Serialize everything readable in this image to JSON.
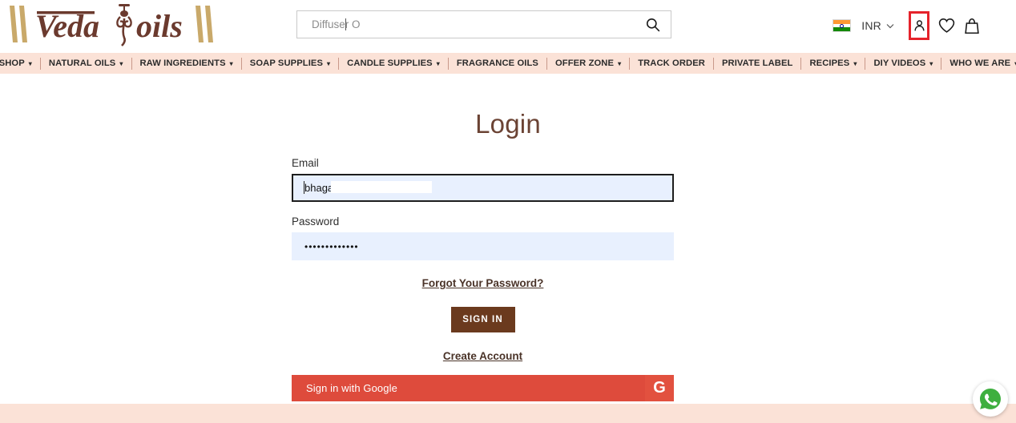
{
  "brand": {
    "name": "VedaOils",
    "logo_part_1": "Veda",
    "logo_part_2": "oils",
    "logo_color": "#6B3A2E",
    "logo_bar_color": "#C9A96A"
  },
  "header": {
    "search": {
      "value": "Diffuser O",
      "placeholder": "Diffuser O",
      "icon": "search-icon"
    },
    "currency": {
      "code": "INR",
      "flag": "india-flag-icon",
      "chevron": "chevron-down-icon"
    },
    "icons": {
      "account": "user-account-icon",
      "wishlist": "heart-icon",
      "cart": "shopping-bag-icon"
    },
    "highlight_color": "#E5232B"
  },
  "nav": {
    "background": "#FBE2D7",
    "items": [
      {
        "label": "SHOP",
        "has_chevron": true
      },
      {
        "label": "NATURAL OILS",
        "has_chevron": true
      },
      {
        "label": "RAW INGREDIENTS",
        "has_chevron": true
      },
      {
        "label": "SOAP SUPPLIES",
        "has_chevron": true
      },
      {
        "label": "CANDLE SUPPLIES",
        "has_chevron": true
      },
      {
        "label": "FRAGRANCE OILS",
        "has_chevron": false
      },
      {
        "label": "OFFER ZONE",
        "has_chevron": true
      },
      {
        "label": "TRACK ORDER",
        "has_chevron": false
      },
      {
        "label": "PRIVATE LABEL",
        "has_chevron": false
      },
      {
        "label": "RECIPES",
        "has_chevron": true
      },
      {
        "label": "DIY VIDEOS",
        "has_chevron": true
      },
      {
        "label": "WHO WE ARE",
        "has_chevron": true
      }
    ]
  },
  "login": {
    "title": "Login",
    "title_color": "#6B4334",
    "email": {
      "label": "Email",
      "value": "bhagat",
      "placeholder": ""
    },
    "password": {
      "label": "Password",
      "value": "•••••••••••••",
      "placeholder": ""
    },
    "forgot_password_link": "Forgot Your Password?",
    "sign_in_button": "SIGN IN",
    "sign_in_button_color": "#6B3A1E",
    "create_account_link": "Create Account",
    "google_button": {
      "label": "Sign in with Google",
      "icon_letter": "G",
      "color": "#DE4B3C"
    }
  },
  "floating": {
    "whatsapp": "whatsapp-icon",
    "whatsapp_color": "#3EAF3F"
  }
}
